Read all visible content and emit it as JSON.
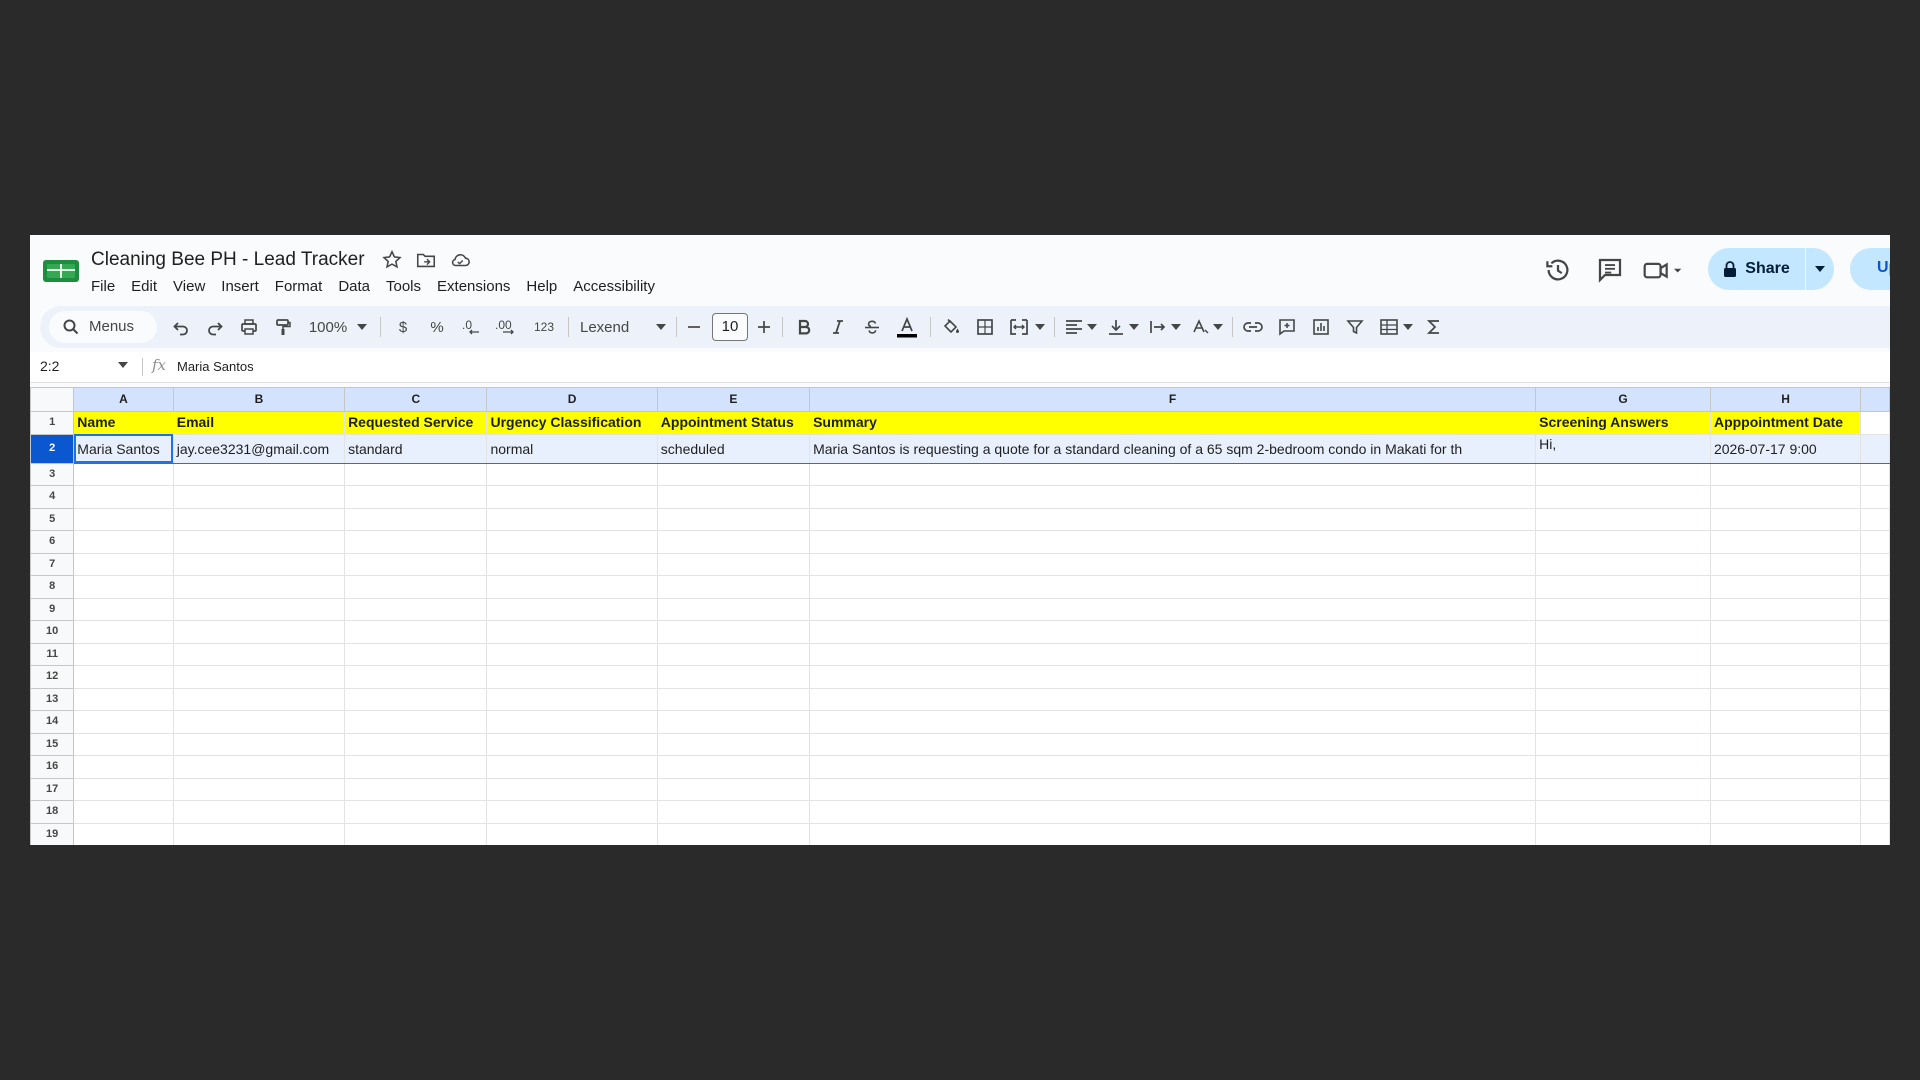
{
  "doc": {
    "title": "Cleaning Bee PH - Lead Tracker"
  },
  "menubar": [
    "File",
    "Edit",
    "View",
    "Insert",
    "Format",
    "Data",
    "Tools",
    "Extensions",
    "Help",
    "Accessibility"
  ],
  "header_actions": {
    "share_label": "Share",
    "upgrade_label": "Up"
  },
  "toolbar": {
    "search_label": "Menus",
    "zoom": "100%",
    "currency": "$",
    "percent": "%",
    "number_format": "123",
    "font": "Lexend",
    "font_size": "10"
  },
  "formula_bar": {
    "cell_ref": "2:2",
    "fx": "fx",
    "value": "Maria Santos"
  },
  "sheet": {
    "column_letters": [
      "A",
      "B",
      "C",
      "D",
      "E",
      "F",
      "G",
      "H"
    ],
    "row_numbers": [
      "1",
      "2",
      "3",
      "4",
      "5",
      "6",
      "7",
      "8",
      "9",
      "10",
      "11",
      "12",
      "13",
      "14",
      "15",
      "16",
      "17",
      "18",
      "19"
    ],
    "headers": [
      "Name",
      "Email",
      "Requested Service",
      "Urgency Classification",
      "Appointment Status",
      "Summary",
      "Screening Answers",
      "Apppointment Date"
    ],
    "rows": [
      [
        "Maria Santos",
        "jay.cee3231@gmail.com",
        "standard",
        "normal",
        "scheduled",
        "Maria Santos is requesting a quote for a standard cleaning of a 65 sqm 2-bedroom condo in Makati for th",
        "Hi,",
        "2026-07-17 9:00"
      ]
    ],
    "header_fill": "#ffff00",
    "selection_color": "#0b57d0"
  }
}
